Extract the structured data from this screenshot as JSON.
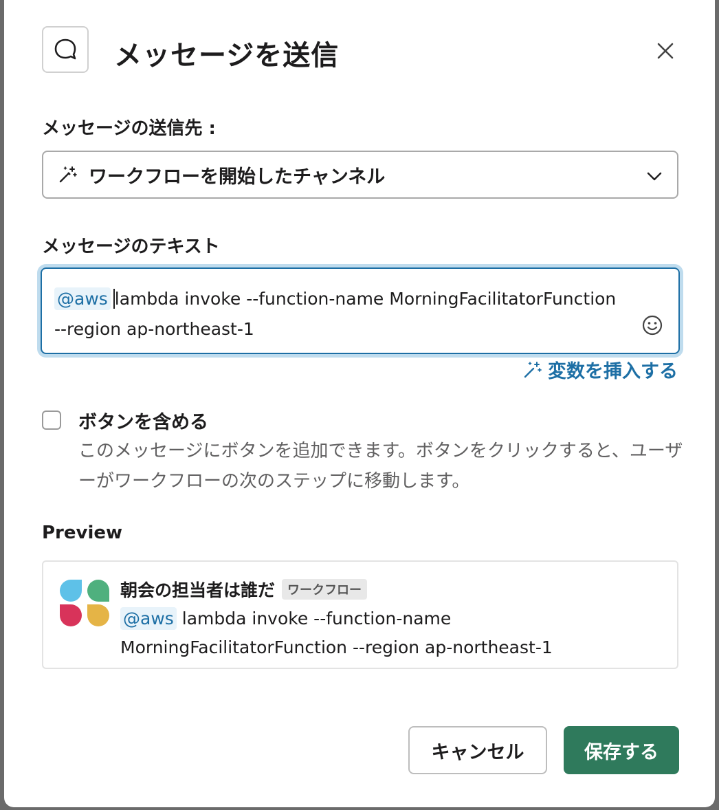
{
  "dialog": {
    "title": "メッセージを送信"
  },
  "recipient": {
    "label": "メッセージの送信先 :",
    "selected": "ワークフローを開始したチャンネル"
  },
  "message": {
    "label": "メッセージのテキスト",
    "mention": "@aws",
    "text": "lambda invoke --function-name MorningFacilitatorFunction --region ap-northeast-1",
    "insert_variable": "変数を挿入する"
  },
  "include_button": {
    "label": "ボタンを含める",
    "checked": false,
    "description": "このメッセージにボタンを追加できます。ボタンをクリックすると、ユーザーがワークフローの次のステップに移動します。"
  },
  "preview": {
    "label": "Preview",
    "sender": "朝会の担当者は誰だ",
    "badge": "ワークフロー",
    "mention": "@aws",
    "text_line1": "lambda invoke --function-name",
    "text_line2": "MorningFacilitatorFunction --region ap-northeast-1"
  },
  "footer": {
    "cancel": "キャンセル",
    "save": "保存する"
  },
  "colors": {
    "accent": "#1d6fa5",
    "save_button": "#2f7a5c",
    "logo_blue": "#5ec1e8",
    "logo_green": "#4fb07e",
    "logo_red": "#d8335a",
    "logo_yellow": "#e5b446"
  }
}
